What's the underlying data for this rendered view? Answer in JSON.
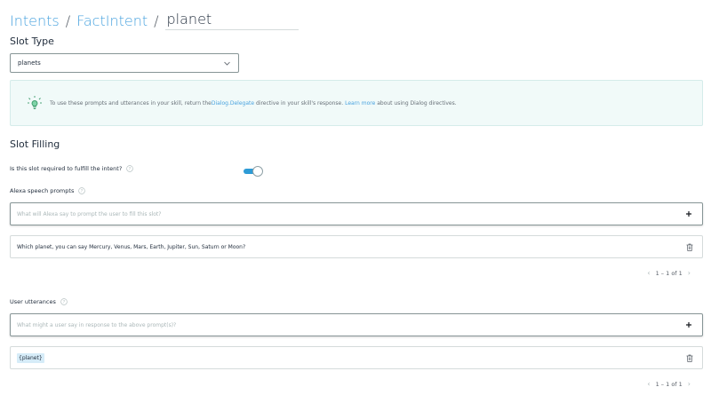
{
  "breadcrumb": {
    "intents_label": "Intents",
    "separator": "/",
    "intent_label": "FactIntent",
    "slot_name": "planet"
  },
  "slot_type": {
    "title": "Slot Type",
    "selected": "planets"
  },
  "info": {
    "text_before": "To use these prompts and utterances in your skill, return the ",
    "link_dialog": "Dialog.Delegate",
    "text_middle": " directive in your skill's response. ",
    "link_learn": "Learn more",
    "text_after": " about using Dialog directives."
  },
  "slot_filling": {
    "title": "Slot Filling",
    "required_label": "Is this slot required to fulfill the intent?",
    "required_enabled": true
  },
  "prompts": {
    "label": "Alexa speech prompts",
    "placeholder": "What will Alexa say to prompt the user to fill this slot?",
    "items": [
      "Which planet, you can say Mercury, Venus, Mars, Earth, Jupiter, Sun, Saturn or Moon?"
    ],
    "pagination": "1 – 1 of 1"
  },
  "utterances": {
    "label": "User utterances",
    "placeholder": "What might a user say in response to the above prompt(s)?",
    "items": [
      "{planet}"
    ],
    "pagination": "1 – 1 of 1"
  },
  "colors": {
    "link": "#4aa3df",
    "toggle_on": "#2e9bd6",
    "info_bg": "#f1faf9",
    "chip_bg": "#d6ecf8"
  }
}
